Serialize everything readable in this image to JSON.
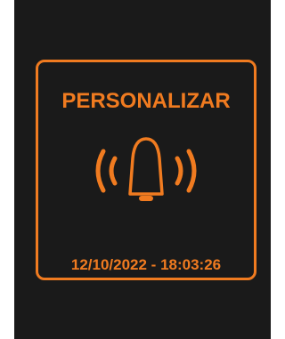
{
  "screen": {
    "title": "PERSONALIZAR",
    "timestamp": "12/10/2022 - 18:03:26",
    "icon": "ringing-bell-icon",
    "accent_color": "#f07b20",
    "background_color": "#1a1a1a"
  }
}
